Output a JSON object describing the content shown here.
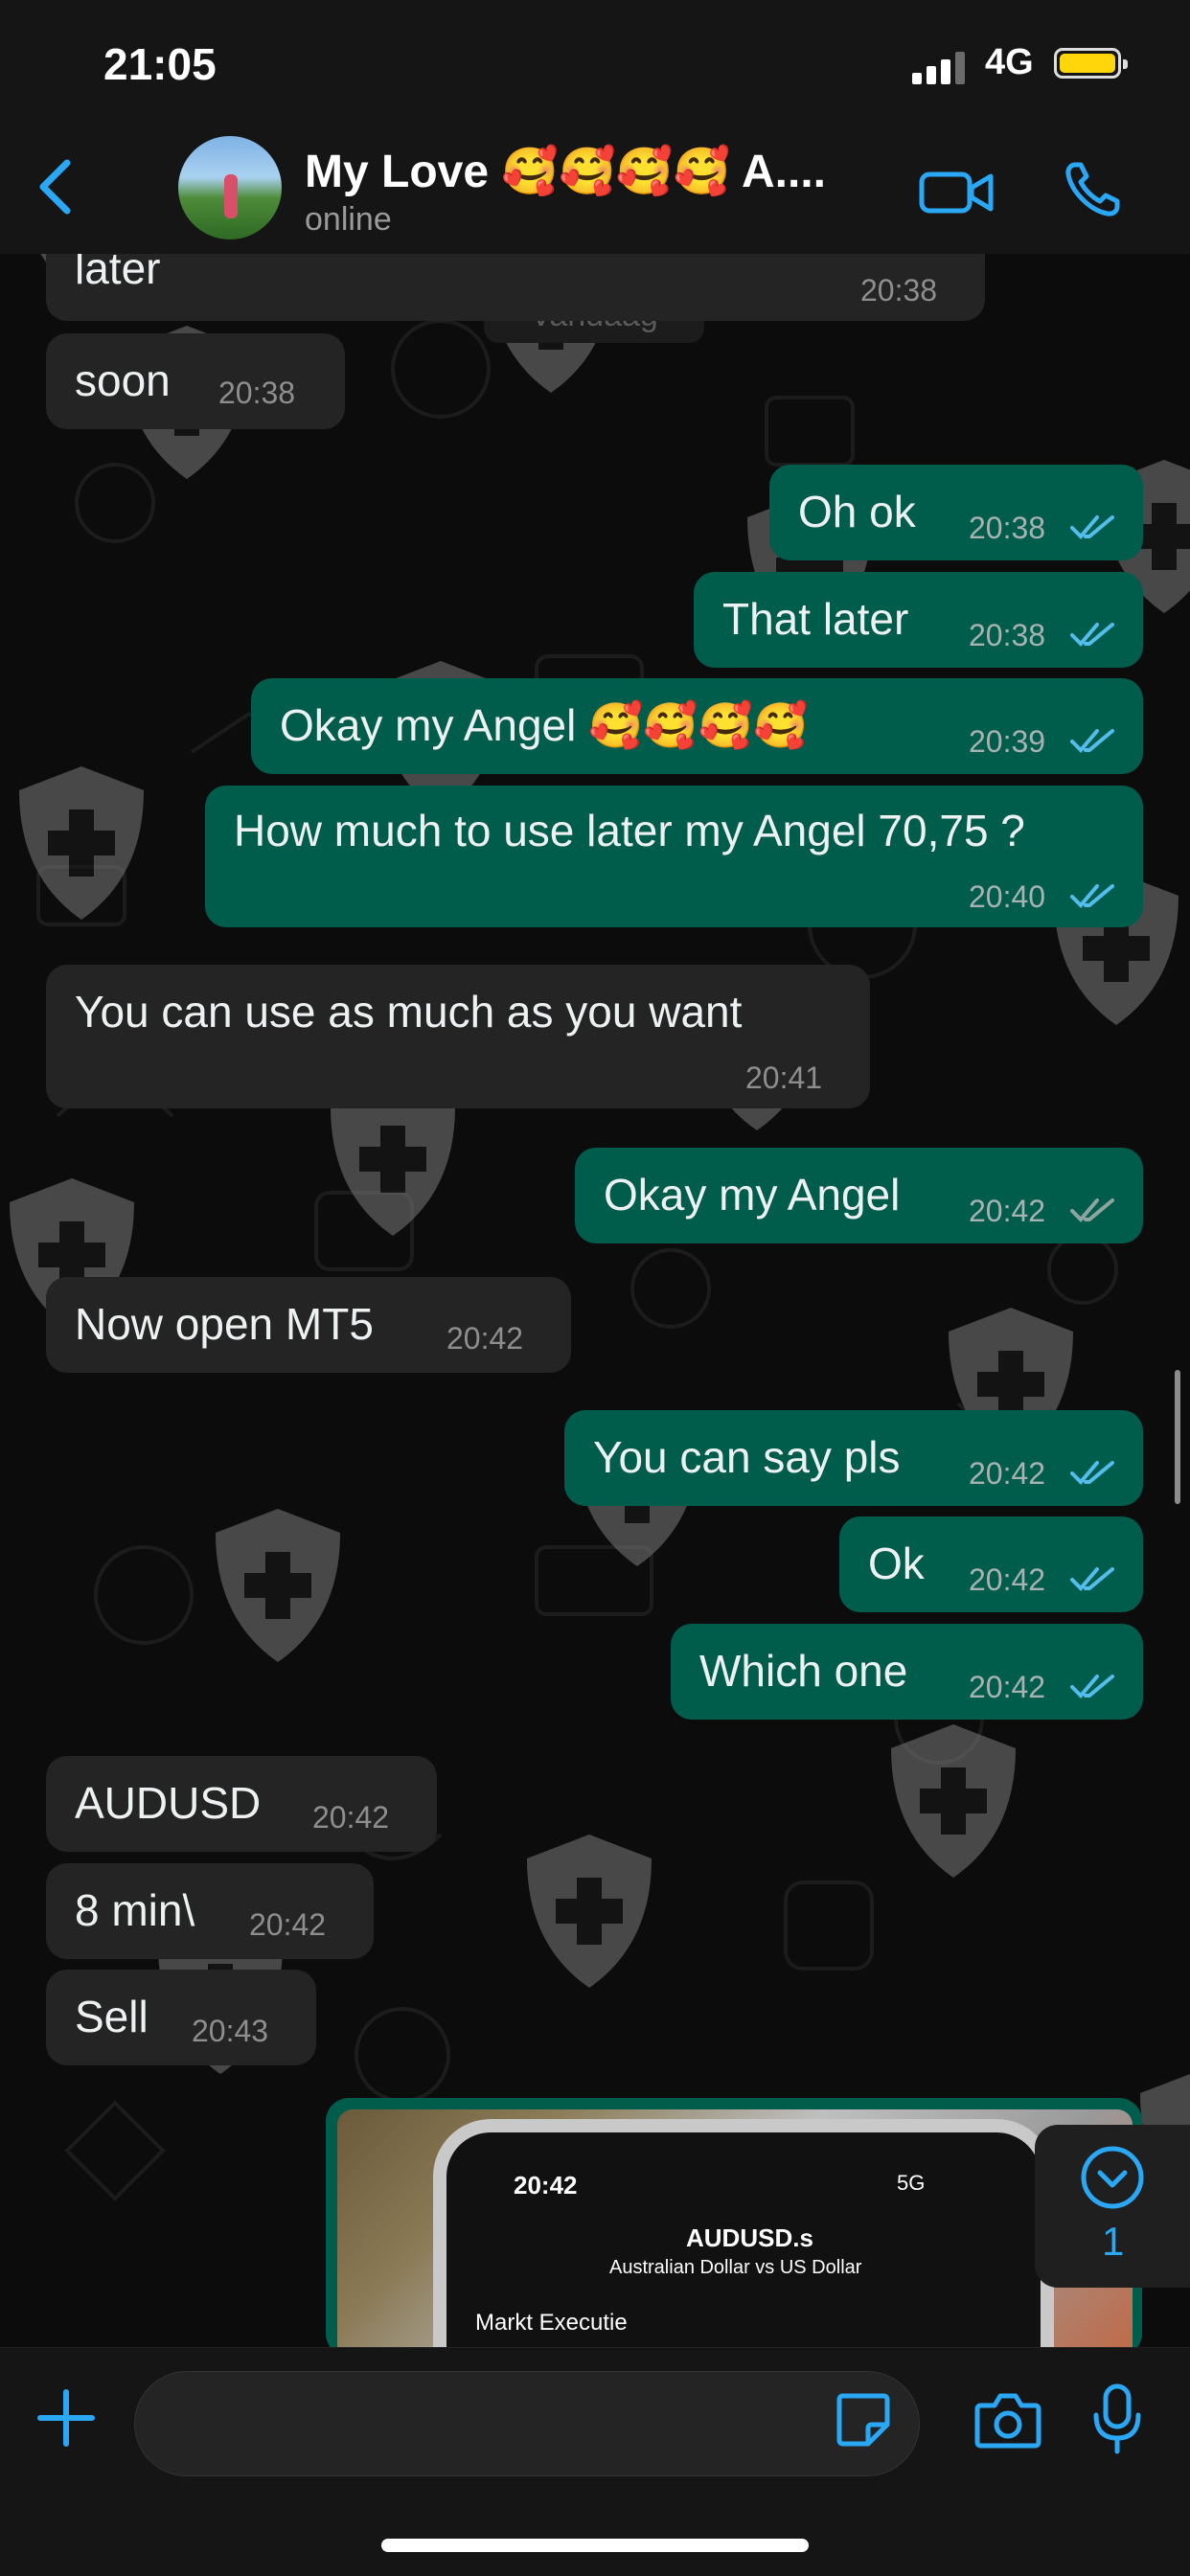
{
  "status_bar": {
    "time": "21:05",
    "network": "4G"
  },
  "header": {
    "contact_name": "My Love 🥰🥰🥰🥰 A....",
    "contact_status": "online",
    "icons": [
      "back-chevron-icon",
      "video-call-icon",
      "phone-call-icon"
    ]
  },
  "day_chip": "Vandaag",
  "messages": [
    {
      "dir": "in",
      "text": "later",
      "time": "20:38"
    },
    {
      "dir": "in",
      "text": "soon",
      "time": "20:38"
    },
    {
      "dir": "out",
      "text": "Oh ok",
      "time": "20:38",
      "status": "read"
    },
    {
      "dir": "out",
      "text": "That later",
      "time": "20:38",
      "status": "read"
    },
    {
      "dir": "out",
      "text": "Okay my Angel 🥰🥰🥰🥰",
      "time": "20:39",
      "status": "read"
    },
    {
      "dir": "out",
      "text": "How much to use later my Angel 70,75 ?",
      "time": "20:40",
      "status": "read"
    },
    {
      "dir": "in",
      "text": "You can use as much as you want",
      "time": "20:41"
    },
    {
      "dir": "out",
      "text": "Okay my Angel",
      "time": "20:42",
      "status": "delivered"
    },
    {
      "dir": "in",
      "text": "Now open MT5",
      "time": "20:42"
    },
    {
      "dir": "out",
      "text": "You can say pls",
      "time": "20:42",
      "status": "read"
    },
    {
      "dir": "out",
      "text": "Ok",
      "time": "20:42",
      "status": "read"
    },
    {
      "dir": "out",
      "text": "Which one",
      "time": "20:42",
      "status": "read"
    },
    {
      "dir": "in",
      "text": "AUDUSD",
      "time": "20:42"
    },
    {
      "dir": "in",
      "text": "8 min\\",
      "time": "20:42"
    },
    {
      "dir": "in",
      "text": "Sell",
      "time": "20:43"
    }
  ],
  "image_message": {
    "screen_time": "20:42",
    "screen_title": "AUDUSD.s",
    "screen_subtitle": "Australian Dollar vs US Dollar",
    "screen_mode": "Markt Executie",
    "screen_network": "5G"
  },
  "scroll_down": {
    "unread_count": "1"
  },
  "composer": {
    "placeholder": ""
  },
  "colors": {
    "incoming_bubble": "#242424",
    "outgoing_bubble": "#005c4b",
    "accent_blue": "#2aa7f5",
    "read_tick": "#53bdeb",
    "delivered_tick": "#8ea59f"
  }
}
